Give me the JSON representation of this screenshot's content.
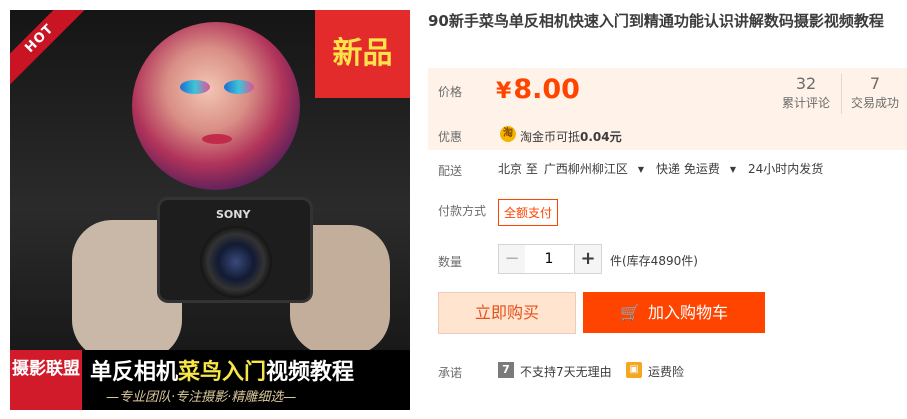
{
  "product_image": {
    "hot_label": "HOT",
    "new_badge": "新品",
    "camera_brand": "SONY",
    "banner_tag": "摄影联盟",
    "banner_title_white": "单反相机",
    "banner_title_yellow": "菜鸟入门",
    "banner_title_white2": "视频教程",
    "banner_sub": "—专业团队·专注摄影·精雕细选—"
  },
  "title": "90新手菜鸟单反相机快速入门到精通功能认识讲解数码摄影视频教程",
  "price": {
    "label": "价格",
    "currency": "¥",
    "value": "8.00",
    "reviews_count": "32",
    "reviews_label": "累计评论",
    "sales_count": "7",
    "sales_label": "交易成功"
  },
  "promo": {
    "label": "优惠",
    "icon_char": "淘",
    "text_prefix": "淘金币可抵",
    "text_amount": "0.04元"
  },
  "shipping": {
    "label": "配送",
    "from": "北京 至",
    "to": "广西柳州柳江区",
    "method": "快递 免运费",
    "dispatch": "24小时内发货"
  },
  "payment": {
    "label": "付款方式",
    "option": "全额支付"
  },
  "quantity": {
    "label": "数量",
    "minus": "−",
    "plus": "+",
    "value": "1",
    "stock": "件(库存4890件)"
  },
  "actions": {
    "buy_now": "立即购买",
    "add_to_cart": "加入购物车"
  },
  "promise": {
    "label": "承诺",
    "icon_7": "7",
    "text_1": "不支持7天无理由",
    "text_2": "运费险"
  },
  "colors": {
    "accent": "#ff4400",
    "price_bg": "#fff2e8"
  }
}
